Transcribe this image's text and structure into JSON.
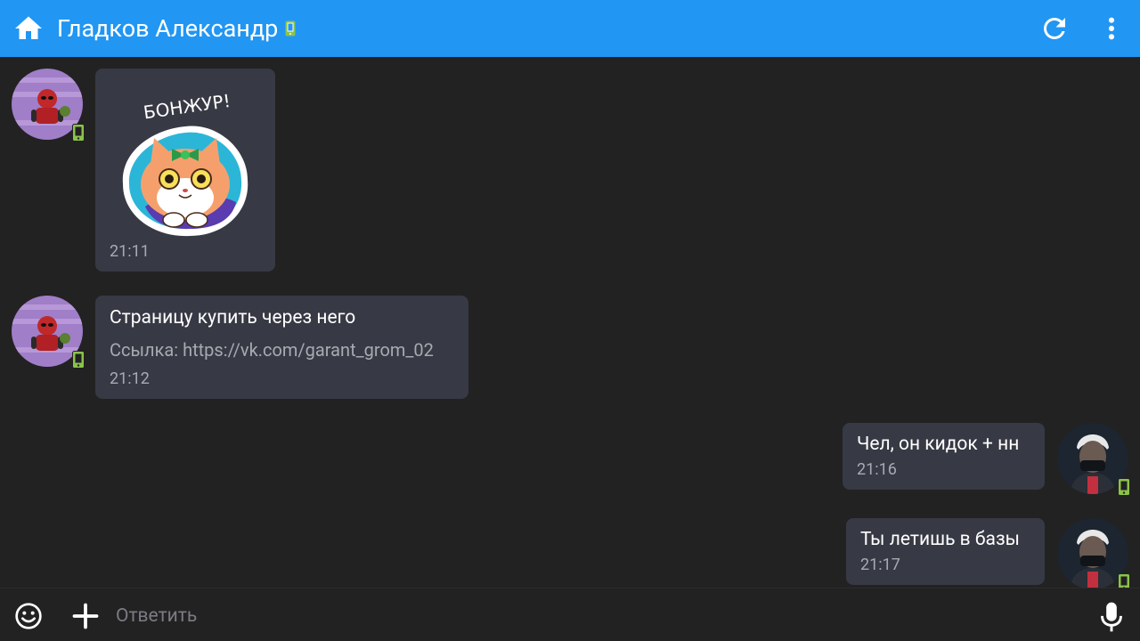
{
  "header": {
    "title": "Гладков Александр",
    "home_icon": "home-icon",
    "refresh_icon": "refresh-icon",
    "menu_icon": "more-vert-icon",
    "background_color": "#2196f3"
  },
  "messages": [
    {
      "side": "incoming",
      "type": "sticker",
      "sticker_text": "БОНЖУР!",
      "time": "21:11"
    },
    {
      "side": "incoming",
      "type": "text",
      "text": "Страницу купить через него",
      "link": "Ссылка: https://vk.com/garant_grom_02",
      "time": "21:12"
    },
    {
      "side": "outgoing",
      "type": "text",
      "text": "Чел, он кидок + нн",
      "time": "21:16"
    },
    {
      "side": "outgoing",
      "type": "text",
      "text": "Ты летишь в базы",
      "time": "21:17"
    }
  ],
  "composer": {
    "placeholder": "Ответить",
    "emoji_icon": "emoji-icon",
    "attach_icon": "plus-icon",
    "mic_icon": "microphone-icon"
  },
  "colors": {
    "background": "#222222",
    "bubble": "#373944",
    "secondary_text": "#a8aab2",
    "mobile_badge": "#8bc34a"
  }
}
